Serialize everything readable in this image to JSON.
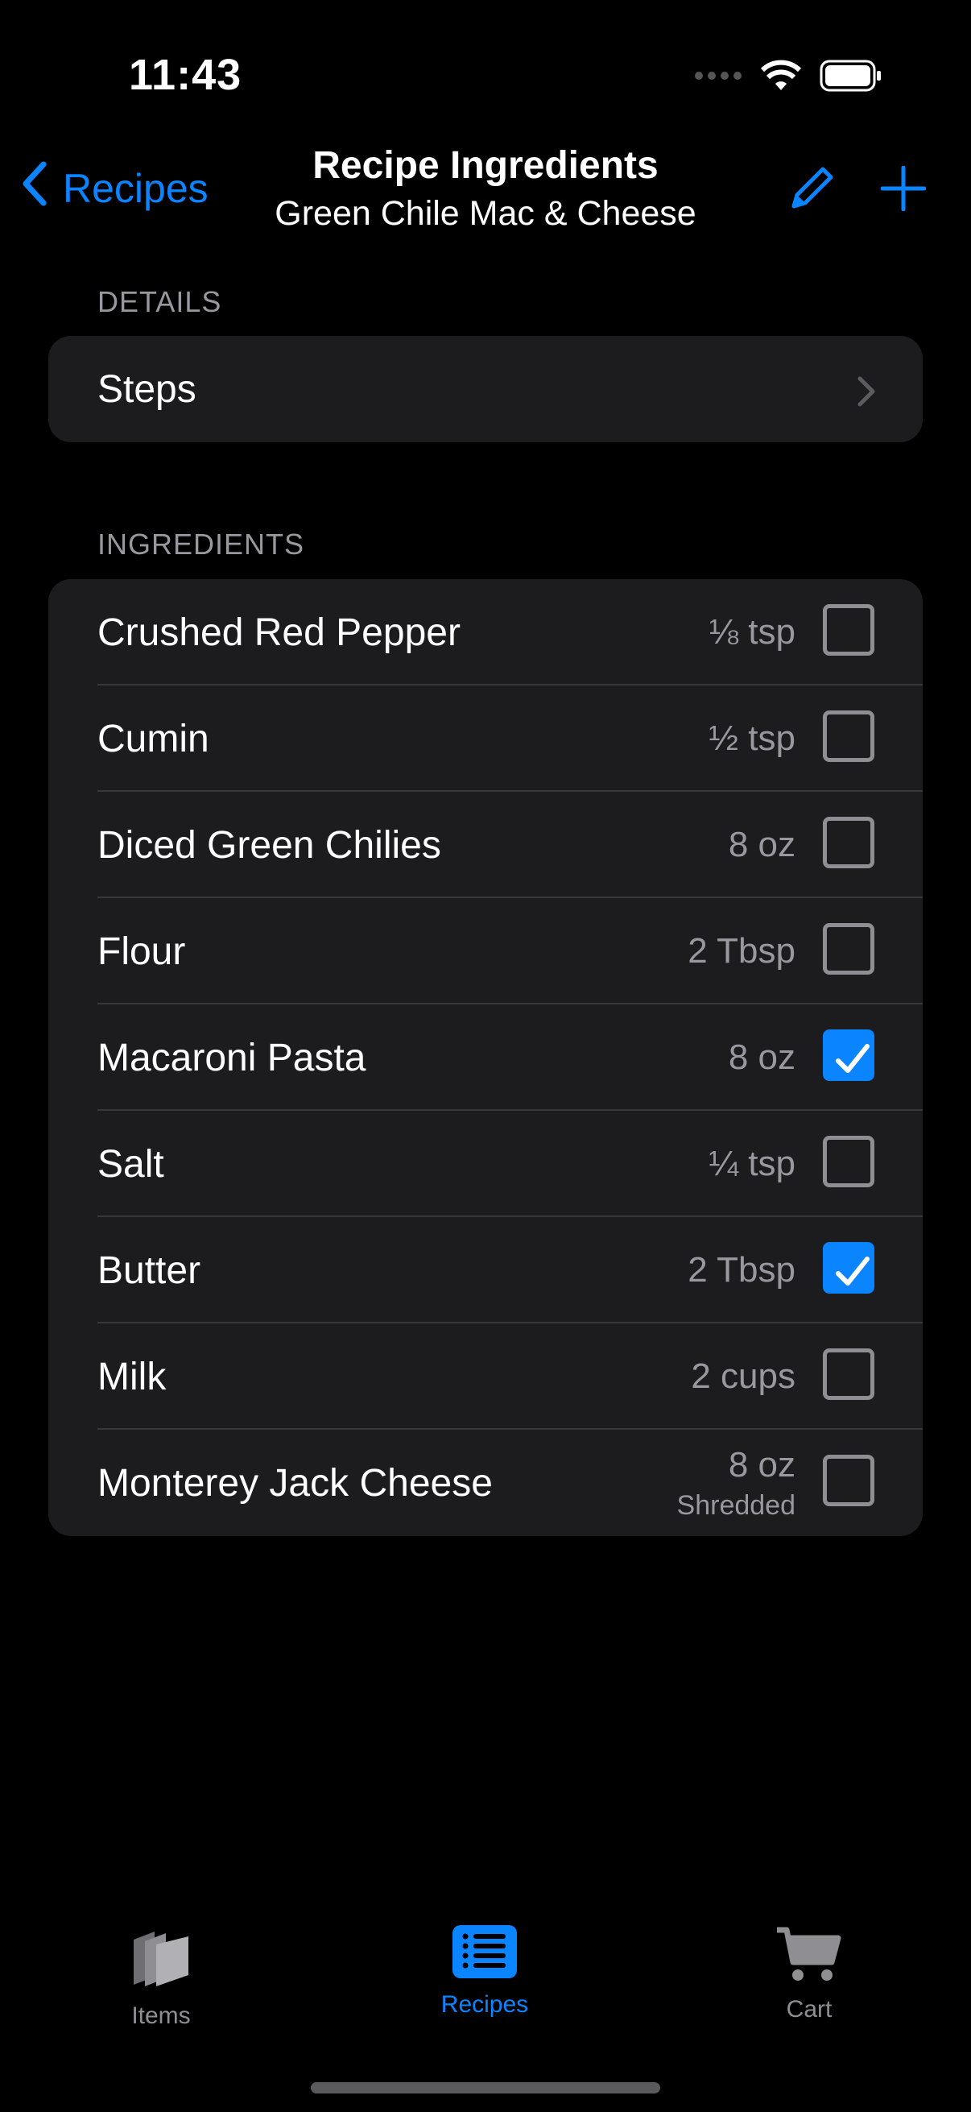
{
  "status": {
    "time": "11:43"
  },
  "nav": {
    "back_label": "Recipes",
    "title": "Recipe Ingredients",
    "subtitle": "Green Chile Mac & Cheese"
  },
  "details": {
    "header": "DETAILS",
    "steps_label": "Steps"
  },
  "ingredients": {
    "header": "INGREDIENTS",
    "items": [
      {
        "name": "Crushed Red Pepper",
        "qty": "⅛ tsp",
        "note": "",
        "checked": false
      },
      {
        "name": "Cumin",
        "qty": "½ tsp",
        "note": "",
        "checked": false
      },
      {
        "name": "Diced Green Chilies",
        "qty": "8 oz",
        "note": "",
        "checked": false
      },
      {
        "name": "Flour",
        "qty": "2 Tbsp",
        "note": "",
        "checked": false
      },
      {
        "name": "Macaroni Pasta",
        "qty": "8 oz",
        "note": "",
        "checked": true
      },
      {
        "name": "Salt",
        "qty": "¼ tsp",
        "note": "",
        "checked": false
      },
      {
        "name": "Butter",
        "qty": "2 Tbsp",
        "note": "",
        "checked": true
      },
      {
        "name": "Milk",
        "qty": "2 cups",
        "note": "",
        "checked": false
      },
      {
        "name": "Monterey Jack Cheese",
        "qty": "8 oz",
        "note": "Shredded",
        "checked": false
      }
    ]
  },
  "tabs": {
    "items_label": "Items",
    "recipes_label": "Recipes",
    "cart_label": "Cart",
    "active": "recipes"
  },
  "colors": {
    "accent": "#0a84ff",
    "card": "#1c1c1e",
    "secondary_text": "#98989e"
  }
}
